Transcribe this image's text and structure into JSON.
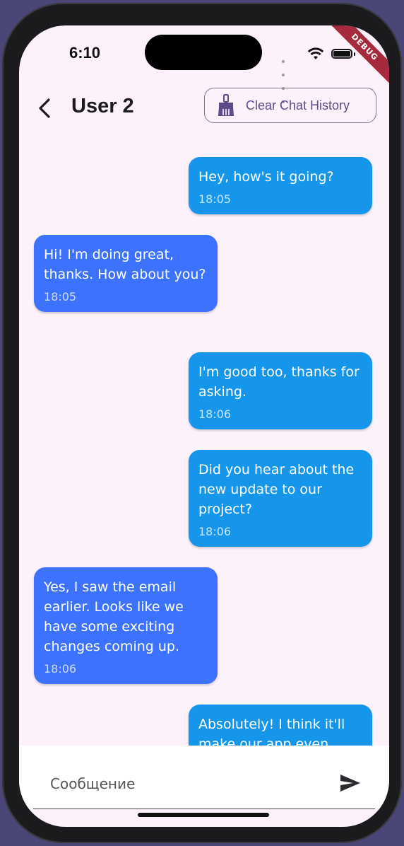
{
  "status_bar": {
    "time": "6:10"
  },
  "debug_banner": "DEBUG",
  "app_bar": {
    "title": "User 2",
    "clear_button_label": "Clear Chat History"
  },
  "messages": [
    {
      "sender": "me",
      "text": "Hey, how's it going?",
      "time": "18:05"
    },
    {
      "sender": "other",
      "text": "Hi! I'm doing great, thanks. How about you?",
      "time": "18:05"
    },
    {
      "sender": "me",
      "text": "I'm good too, thanks for asking.",
      "time": "18:06"
    },
    {
      "sender": "me",
      "text": "Did you hear about the new update to our project?",
      "time": "18:06"
    },
    {
      "sender": "other",
      "text": "Yes, I saw the email earlier. Looks like we have some exciting changes coming up.",
      "time": "18:06"
    },
    {
      "sender": "me",
      "text": "Absolutely! I think it'll make our app even",
      "time": ""
    }
  ],
  "composer": {
    "placeholder": "Сообщение"
  },
  "colors": {
    "sent_bubble": "#1596ea",
    "received_bubble": "#3c72fd",
    "background": "#fdf1fc",
    "accent": "#5e4b8b"
  },
  "icons": {
    "back": "arrow-back-icon",
    "clear": "broom-icon",
    "send": "send-icon"
  }
}
